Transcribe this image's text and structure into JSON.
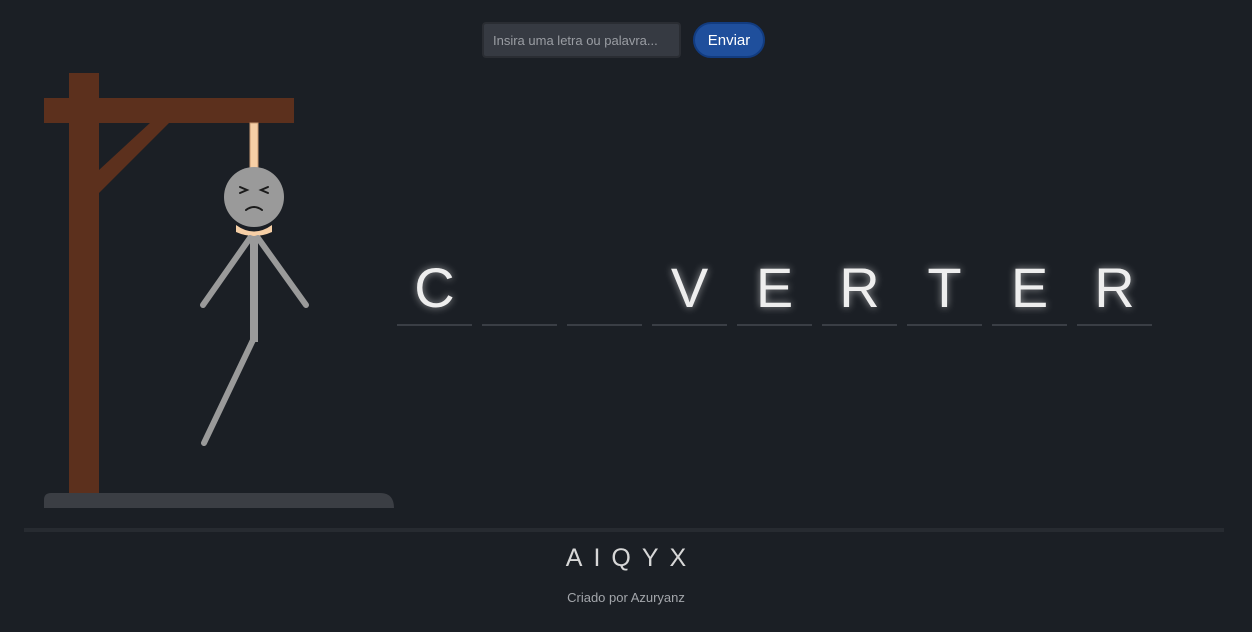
{
  "form": {
    "input_placeholder": "Insira uma letra ou palavra...",
    "input_value": "",
    "submit_label": "Enviar"
  },
  "word": {
    "slots": [
      "C",
      "",
      "",
      "V",
      "E",
      "R",
      "T",
      "E",
      "R"
    ]
  },
  "wrong_letters": "AIQYX",
  "credit": "Criado por Azuryanz",
  "colors": {
    "background": "#1b1f25",
    "gallows_wood": "#5c301d",
    "rope": "#f6cfa6",
    "body": "#9a9a9a",
    "button": "#1f4f9c"
  }
}
